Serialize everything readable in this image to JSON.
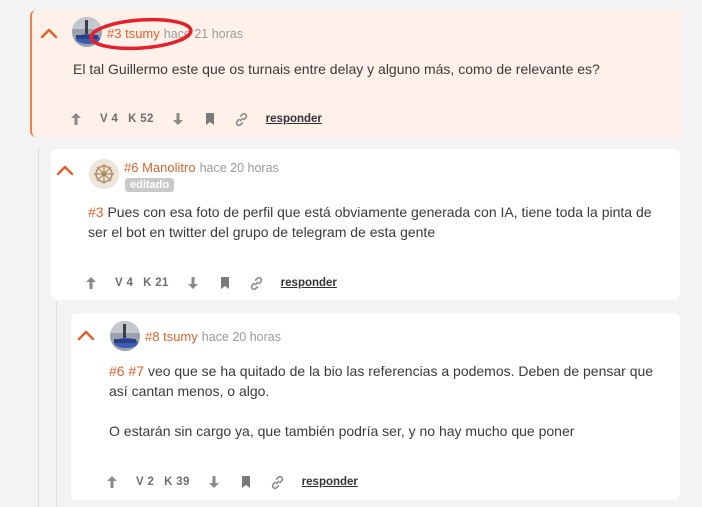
{
  "comments": [
    {
      "number": "#3",
      "author": "tsumy",
      "time": "hace 21 horas",
      "edited": "",
      "text": "El tal Guillermo este que os turnais entre delay y alguno más, como de relevante es?",
      "votes": "V 4",
      "karma": "K 52",
      "reply": "responder"
    },
    {
      "number": "#6",
      "author": "Manolitro",
      "time": "hace 20 horas",
      "edited": "editado",
      "ref": "#3",
      "text": "Pues con esa foto de perfil que está obviamente generada con IA, tiene toda la pinta de ser el bot en twitter del grupo de telegram de esta gente",
      "votes": "V 4",
      "karma": "K 21",
      "reply": "responder"
    },
    {
      "number": "#8",
      "author": "tsumy",
      "time": "hace 20 horas",
      "ref1": "#6",
      "ref2": "#7",
      "text1": "veo que se ha quitado de la bio las referencias a podemos. Deben de pensar que así cantan menos, o algo.",
      "text2": "O estarán sin cargo ya, que también podría ser, y no hay mucho que poner",
      "votes": "V 2",
      "karma": "K 39",
      "reply": "responder"
    }
  ],
  "icons": {
    "collapse": "chevron-up-icon",
    "upvote": "arrow-up-icon",
    "downvote": "arrow-down-icon",
    "save": "bookmark-icon",
    "link": "link-icon"
  },
  "colors": {
    "accent": "#e1622d",
    "highlight_bg": "#fdf1ea",
    "annotation": "#e5202a"
  }
}
